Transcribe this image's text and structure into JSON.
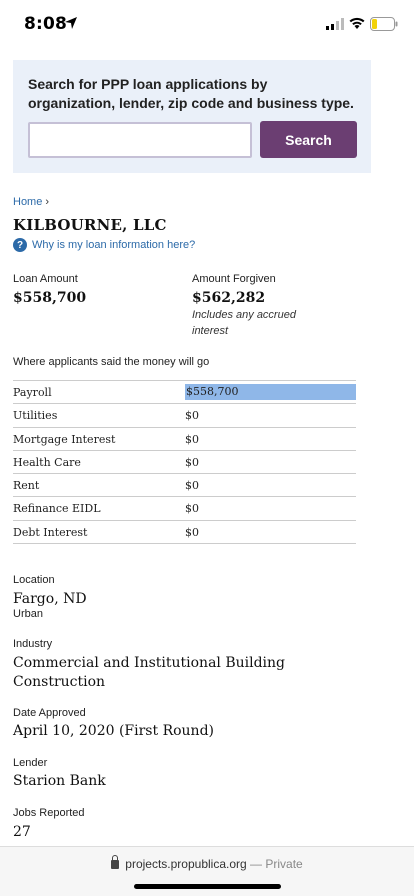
{
  "status": {
    "time": "8:08"
  },
  "search": {
    "prompt": "Search for PPP loan applications by organization, lender, zip code and business type.",
    "placeholder": "",
    "button_label": "Search"
  },
  "breadcrumb": {
    "home": "Home",
    "sep": "›"
  },
  "entity": {
    "name": "KILBOURNE, LLC",
    "why_link": "Why is my loan information here?"
  },
  "stats": {
    "loan_label": "Loan Amount",
    "loan_value": "$558,700",
    "forgiven_label": "Amount Forgiven",
    "forgiven_value": "$562,282",
    "forgiven_note": "Includes any accrued interest"
  },
  "uses": {
    "heading": "Where applicants said the money will go",
    "rows": [
      {
        "label": "Payroll",
        "value": "$558,700"
      },
      {
        "label": "Utilities",
        "value": "$0"
      },
      {
        "label": "Mortgage Interest",
        "value": "$0"
      },
      {
        "label": "Health Care",
        "value": "$0"
      },
      {
        "label": "Rent",
        "value": "$0"
      },
      {
        "label": "Refinance EIDL",
        "value": "$0"
      },
      {
        "label": "Debt Interest",
        "value": "$0"
      }
    ]
  },
  "details": {
    "location_label": "Location",
    "location_value": "Fargo, ND",
    "location_sub": "Urban",
    "industry_label": "Industry",
    "industry_value": "Commercial and Institutional Building Construction",
    "date_label": "Date Approved",
    "date_value": "April 10, 2020 (First Round)",
    "lender_label": "Lender",
    "lender_value": "Starion Bank",
    "jobs_label": "Jobs Reported",
    "jobs_value": "27"
  },
  "browser": {
    "domain": "projects.propublica.org",
    "private": "— Private"
  },
  "colors": {
    "accent": "#6b3e72",
    "panel": "#eaf0f9",
    "link": "#2c6aa8",
    "highlight": "#8fb7e8"
  }
}
